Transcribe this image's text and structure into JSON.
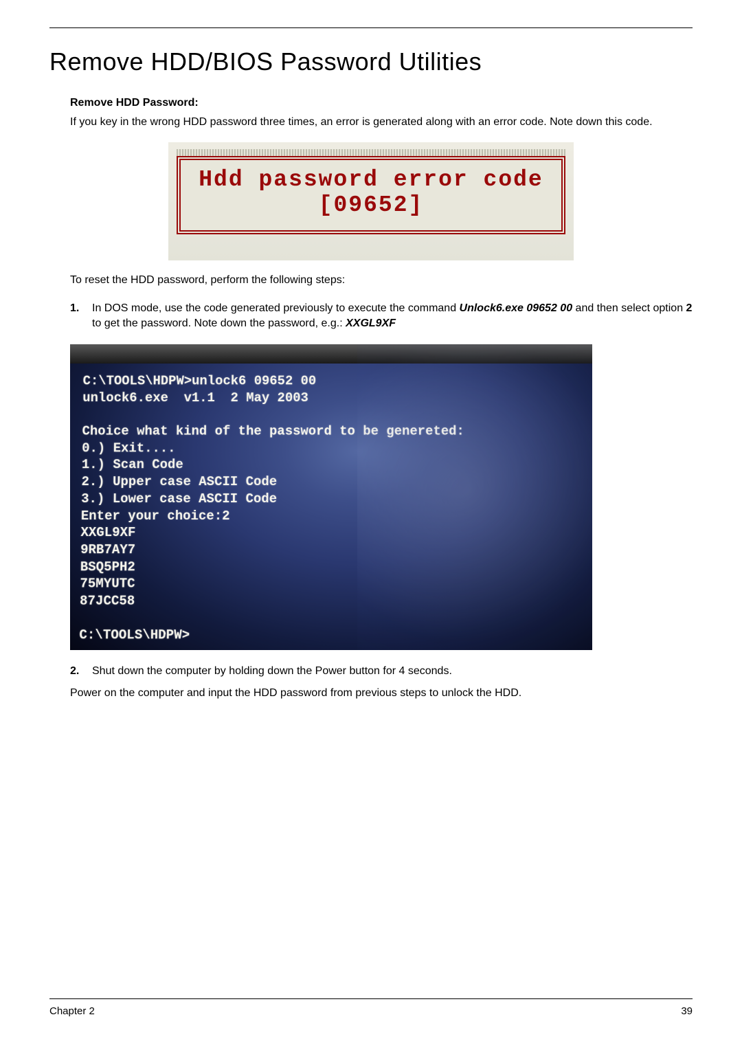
{
  "title": "Remove HDD/BIOS Password Utilities",
  "section_heading": "Remove HDD Password:",
  "intro": "If you key in the wrong HDD password three times, an error is generated along with an error code. Note down this code.",
  "error_box": {
    "line1": "Hdd password error code",
    "line2": "[09652]"
  },
  "reset_intro": "To reset the HDD password, perform the following steps:",
  "steps": {
    "one": {
      "num": "1.",
      "pre": "In DOS mode, use the code generated previously to execute the command ",
      "cmd": "Unlock6.exe 09652 00",
      "mid": " and then select option ",
      "opt": "2",
      "mid2": " to get the password. Note down the password, e.g.: ",
      "pwd": "XXGL9XF"
    },
    "two": {
      "num": "2.",
      "text": "Shut down the computer by holding down the Power button for 4 seconds."
    }
  },
  "dos": "C:\\TOOLS\\HDPW>unlock6 09652 00\nunlock6.exe  v1.1  2 May 2003\n\nChoice what kind of the password to be genereted:\n0.) Exit....\n1.) Scan Code\n2.) Upper case ASCII Code\n3.) Lower case ASCII Code\nEnter your choice:2\nXXGL9XF\n9RB7AY7\nBSQ5PH2\n75MYUTC\n87JCC58\n\nC:\\TOOLS\\HDPW>",
  "outro": "Power on the computer and input the HDD password from previous steps to unlock the HDD.",
  "footer": {
    "left": "Chapter 2",
    "right": "39"
  }
}
